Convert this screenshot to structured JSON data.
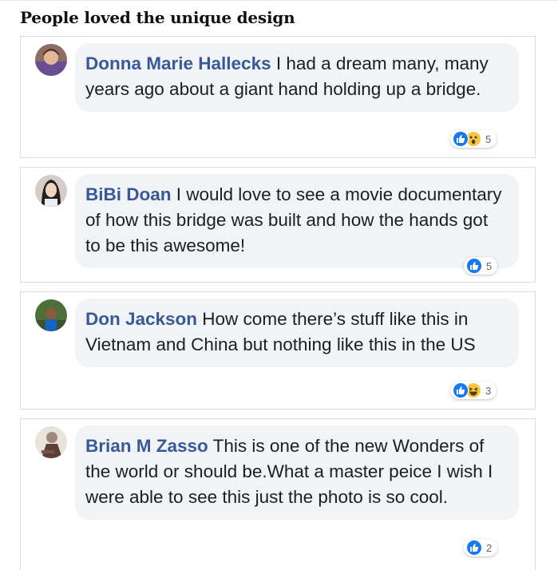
{
  "heading": "People loved the unique design",
  "comments": [
    {
      "author": "Donna Marie Hallecks",
      "text": " I had a dream many, many years ago about a giant hand holding up a bridge.",
      "reactions": [
        "like",
        "wow"
      ],
      "count": "5"
    },
    {
      "author": "BiBi Doan",
      "text": " I would love to see a movie documentary of how this bridge was built and how the hands got to be this awesome!",
      "reactions": [
        "like"
      ],
      "count": "5"
    },
    {
      "author": "Don Jackson",
      "text": " How come there’s stuff like this in Vietnam and China but nothing like this in the US",
      "reactions": [
        "like",
        "haha"
      ],
      "count": "3"
    },
    {
      "author": "Brian M Zasso",
      "text": " This is one of the new Wonders of the world or should be.What a master peice I wish I were able to see this just the photo is so cool.",
      "reactions": [
        "like"
      ],
      "count": "2"
    }
  ],
  "colors": {
    "author": "#385898",
    "bubble": "#f2f3f5",
    "like": "#1877f2",
    "emoji": "#f7c544"
  },
  "icons": [
    "like-icon",
    "wow-icon",
    "haha-icon",
    "avatar"
  ]
}
